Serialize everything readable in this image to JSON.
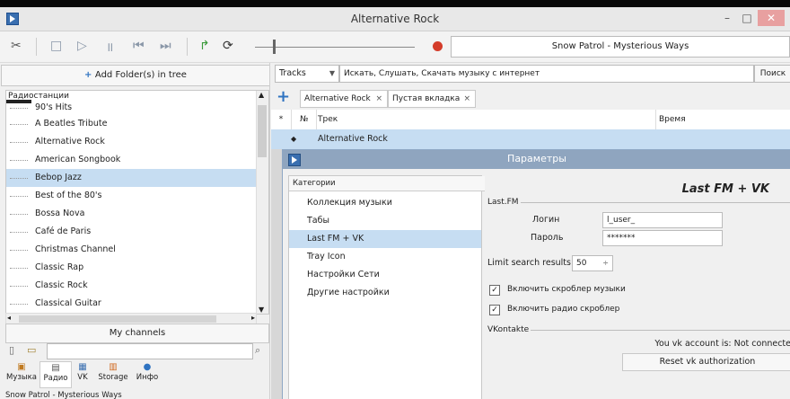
{
  "window": {
    "title": "Alternative Rock",
    "minimize_glyph": "–",
    "maximize_glyph": "□",
    "close_glyph": "✕"
  },
  "toolbar": {
    "icons": [
      "scissors-icon",
      "stop-icon",
      "play-icon",
      "pause-icon",
      "prev-icon",
      "next-icon",
      "arrow-icon",
      "repeat-icon"
    ],
    "now_playing": "Snow Patrol - Mysterious Ways"
  },
  "left": {
    "add_folder": "Add Folder(s) in tree",
    "tree_header": "Радиостанции",
    "tree_items": [
      {
        "label": "90's Hits"
      },
      {
        "label": "A Beatles Tribute"
      },
      {
        "label": "Alternative Rock"
      },
      {
        "label": "American Songbook"
      },
      {
        "label": "Bebop Jazz"
      },
      {
        "label": "Best of the 80's"
      },
      {
        "label": "Bossa Nova"
      },
      {
        "label": "Café de Paris"
      },
      {
        "label": "Christmas Channel"
      },
      {
        "label": "Classic Rap"
      },
      {
        "label": "Classic Rock"
      },
      {
        "label": "Classical Guitar"
      }
    ],
    "selected_index": 4,
    "my_channels": "My channels",
    "tabs": [
      {
        "label": "Музыка",
        "icon": "music-icon"
      },
      {
        "label": "Радио",
        "icon": "radio-icon"
      },
      {
        "label": "VK",
        "icon": "vk-icon"
      },
      {
        "label": "Storage",
        "icon": "storage-icon"
      },
      {
        "label": "Инфо",
        "icon": "info-icon"
      }
    ],
    "active_tab": "Радио",
    "status": "Snow Patrol - Mysterious Ways"
  },
  "search": {
    "type": "Tracks",
    "value": "Искать, Слушать, Скачать музыку с интернет",
    "button": "Поиск"
  },
  "playlist_tabs": [
    {
      "label": "Alternative Rock",
      "close": "×"
    },
    {
      "label": "Пустая вкладка",
      "close": "×"
    }
  ],
  "grid": {
    "col_star": "*",
    "col_num": "№",
    "col_track": "Трек",
    "col_time": "Время",
    "group_row": "Alternative Rock"
  },
  "dialog": {
    "title": "Параметры",
    "categories_header": "Категории",
    "categories": [
      "Коллекция музыки",
      "Табы",
      "Last FM + VK",
      "Tray Icon",
      "Настройки Сети",
      "Другие настройки"
    ],
    "selected_category": 2,
    "section_title": "Last FM + VK",
    "lastfm": {
      "group": "Last.FM",
      "login_label": "Логин",
      "login_value": "l_user_",
      "password_label": "Пароль",
      "password_value": "*******",
      "limit_label": "Limit search results:",
      "limit_value": "50",
      "scrobble_music": "Включить скроблер музыки",
      "scrobble_radio": "Включить радио скроблер"
    },
    "vk": {
      "group": "VKontakte",
      "account_text": "You vk account is: Not connecte",
      "reset_button": "Reset vk authorization"
    }
  }
}
